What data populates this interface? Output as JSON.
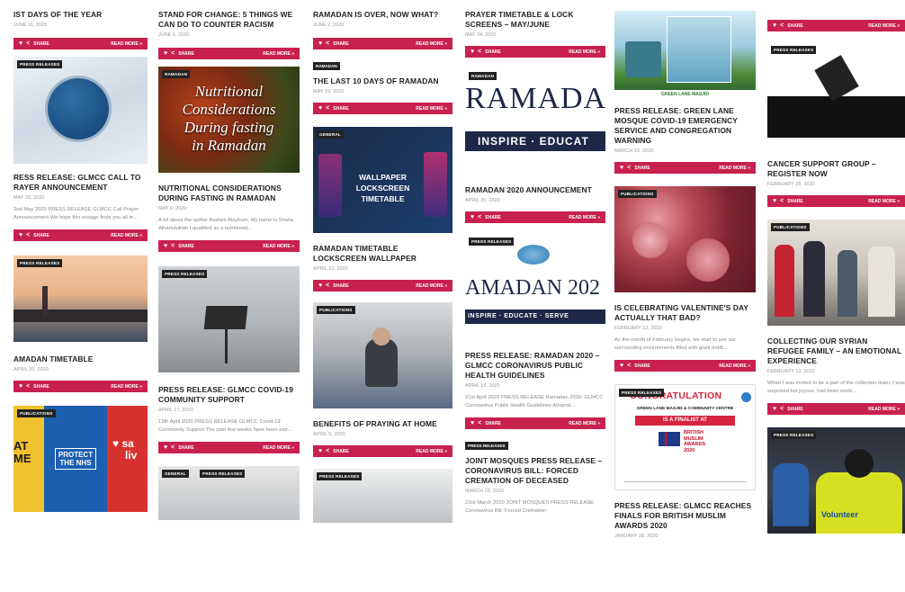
{
  "share_label": "SHARE",
  "read_more_label": "READ MORE »",
  "colors": {
    "accent": "#c8214f",
    "badge": "#222222"
  },
  "columns": [
    {
      "posts": [
        {
          "title": "IST DAYS OF THE YEAR",
          "date": "JUNE 11, 2020"
        },
        {
          "category": "PRESS RELEASES",
          "title": "RESS RELEASE: GLMCC CALL TO RAYER ANNOUNCEMENT",
          "date": "MAY 22, 2020",
          "excerpt": "2nd May 2020 PRESS RELEASE GLMCC Call Prayer Announcement We hope this essage finds you all in..."
        },
        {
          "category": "PRESS RELEASES",
          "title": "AMADAN TIMETABLE",
          "date": "APRIL 20, 2020"
        },
        {
          "category": "PUBLICATIONS",
          "image_text": [
            "AT",
            "ME",
            "PROTECT",
            "THE NHS",
            "sa",
            "liv"
          ]
        }
      ]
    },
    {
      "posts": [
        {
          "title": "STAND FOR CHANGE: 5 THINGS WE CAN DO TO COUNTER RACISM",
          "date": "JUNE 6, 2020"
        },
        {
          "category": "RAMADAN",
          "image_text": [
            "Nutritional",
            "Considerations",
            "During fasting",
            "in Ramadan"
          ],
          "title": "NUTRITIONAL CONSIDERATIONS DURING FASTING IN RAMADAN",
          "date": "MAY 6, 2020",
          "excerpt": "A bit about the author Asalam Alaykum, My name is Shaila. Alhamdulilah I qualified as a nutritional..."
        },
        {
          "category": "PRESS RELEASES",
          "title": "PRESS RELEASE: GLMCC COVID-19 COMMUNITY SUPPORT",
          "date": "APRIL 17, 2020",
          "excerpt": "19th April 2020 PRESS RELEASE GLMCC Covid-19 Community Support The past few weeks have been extr..."
        },
        {
          "category": "GENERAL",
          "category2": "PRESS RELEASES"
        }
      ]
    },
    {
      "posts": [
        {
          "title": "RAMADAN IS OVER, NOW WHAT?",
          "date": "JUNE 2, 2020"
        },
        {
          "category": "RAMADAN",
          "title": "THE LAST 10 DAYS OF RAMADAN",
          "date": "MAY 19, 2020"
        },
        {
          "category": "GENERAL",
          "image_text": [
            "WALLPAPER",
            "LOCKSCREEN",
            "TIMETABLE"
          ],
          "title": "RAMADAN TIMETABLE LOCKSCREEN WALLPAPER",
          "date": "APRIL 23, 2020"
        },
        {
          "category": "PUBLICATIONS",
          "title": "BENEFITS OF PRAYING AT HOME",
          "date": "APRIL 5, 2020"
        },
        {
          "category": "PRESS RELEASES"
        }
      ]
    },
    {
      "posts": [
        {
          "title": "PRAYER TIMETABLE & LOCK SCREENS – MAY/JUNE",
          "date": "MAY 24, 2020"
        },
        {
          "category": "RAMADAN",
          "image_text": [
            "RAMADA",
            "INSPIRE · EDUCAT"
          ],
          "title": "RAMADAN 2020 ANNOUNCEMENT",
          "date": "APRIL 25, 2020"
        },
        {
          "category": "PRESS RELEASES",
          "image_text": [
            "AMADAN 202",
            "INSPIRE · EDUCATE · SERVE"
          ],
          "title": "PRESS RELEASE: RAMADAN 2020 – GLMCC CORONAVIRUS PUBLIC HEALTH GUIDELINES",
          "date": "APRIL 18, 2020",
          "excerpt": "21st April 2020 PRESS RELEASE Ramadan 2020: GLMCC Coronavirus Public Health Guidelines Alhamd..."
        },
        {
          "category": "PRESS RELEASES",
          "title": "JOINT MOSQUES PRESS RELEASE – CORONAVIRUS BILL: FORCED CREMATION OF DECEASED",
          "date": "MARCH 23, 2020",
          "excerpt": "23rd March 2020 JOINT MOSQUES PRESS RELEASE Coronavirus Bill: Forced Cremation"
        }
      ]
    },
    {
      "posts": [
        {
          "image_text": [
            "GREEN LANE MASJID"
          ],
          "title": "PRESS RELEASE: GREEN LANE MOSQUE COVID-19 EMERGENCY SERVICE AND CONGREGATION WARNING",
          "date": "MARCH 13, 2020"
        },
        {
          "category": "PUBLICATIONS",
          "title": "IS CELEBRATING VALENTINE'S DAY ACTUALLY THAT BAD?",
          "date": "FEBRUARY 12, 2020",
          "excerpt": "As the month of February begins, we start to see our surrounding environments filled with giant teddi..."
        },
        {
          "category": "PRESS RELEASES",
          "image_text": [
            "CONGRATULATION",
            "GREEN LANE MASJID & COMMUNITY CENTRE",
            "IS A FINALIST AT",
            "BRITISH MUSLIM AWARDS 2020"
          ],
          "title": "PRESS RELEASE: GLMCC REACHES FINALS FOR BRITISH MUSLIM AWARDS 2020",
          "date": "JANUARY 28, 2020"
        }
      ]
    },
    {
      "posts": [
        {
          "category": "PRESS RELEASES",
          "title": "CANCER SUPPORT GROUP – REGISTER NOW",
          "date": "FEBRUARY 28, 2020"
        },
        {
          "category": "PUBLICATIONS",
          "title": "COLLECTING OUR SYRIAN REFUGEE FAMILY – AN EMOTIONAL EXPERIENCE",
          "date": "FEBRUARY 13, 2020",
          "excerpt": "When I was invited to be a part of the collection team, I was surprised but joyous, had been worki..."
        },
        {
          "category": "PRESS RELEASES",
          "image_text": [
            "Volunteer"
          ]
        }
      ]
    }
  ]
}
